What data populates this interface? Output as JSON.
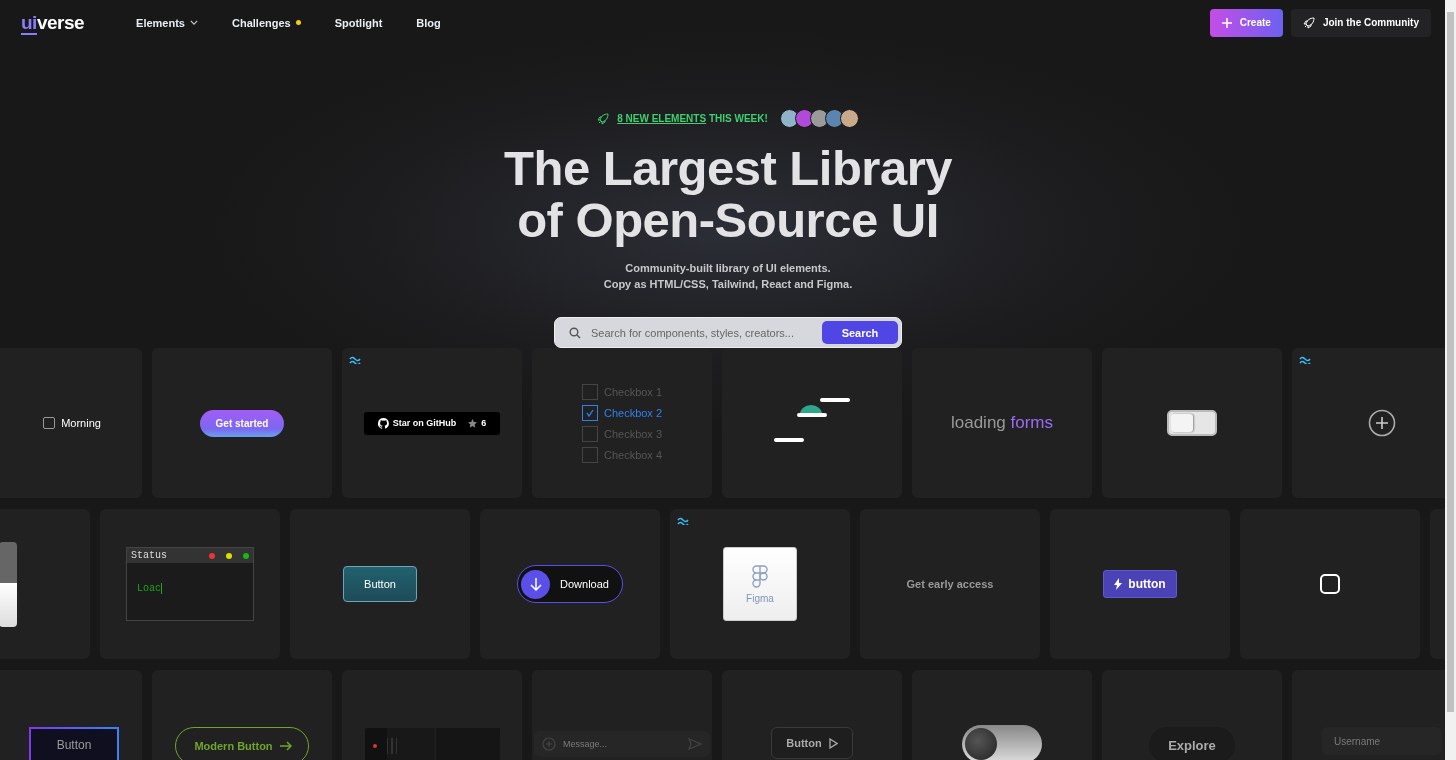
{
  "header": {
    "logo": {
      "accent": "ui",
      "rest": "verse"
    },
    "nav": [
      {
        "label": "Elements",
        "dropdown": true,
        "dot": false
      },
      {
        "label": "Challenges",
        "dropdown": false,
        "dot": true
      },
      {
        "label": "Spotlight",
        "dropdown": false,
        "dot": false
      },
      {
        "label": "Blog",
        "dropdown": false,
        "dot": false
      }
    ],
    "actions": [
      {
        "kind": "primary",
        "label": "Create"
      },
      {
        "kind": "secondary",
        "label": "Join the Community"
      }
    ]
  },
  "hero": {
    "badge": {
      "link": "8 NEW ELEMENTS",
      "rest": "THIS WEEK!"
    },
    "avatars": [
      {
        "color": "#8fb3c9"
      },
      {
        "color": "#b04ad8"
      },
      {
        "color": "#9a9a9a"
      },
      {
        "color": "#5b84b0"
      },
      {
        "color": "#c9a98a"
      }
    ],
    "title": [
      "The Largest Library",
      "of Open-Source UI"
    ],
    "subtitle": [
      "Community-built library of UI elements.",
      "Copy as HTML/CSS, Tailwind, React and Figma."
    ],
    "search": {
      "placeholder": "Search for components, styles, creators...",
      "button": "Search"
    }
  },
  "rows": [
    [
      {
        "kind": "checkbox",
        "label": "Morning",
        "checked": false
      },
      {
        "kind": "gradient-button",
        "label": "Get started"
      },
      {
        "kind": "github-button",
        "label": "Star on GitHub",
        "count": "6",
        "tailwind": true
      },
      {
        "kind": "checkbox-list",
        "items": [
          {
            "label": "Checkbox 1",
            "checked": false
          },
          {
            "label": "Checkbox 2",
            "checked": true
          },
          {
            "label": "Checkbox 3",
            "checked": false
          },
          {
            "label": "Checkbox 4",
            "checked": false
          }
        ]
      },
      {
        "kind": "loader"
      },
      {
        "kind": "loading-text",
        "text": "loading",
        "accent": "forms"
      },
      {
        "kind": "switch",
        "on": false
      },
      {
        "kind": "plus-button",
        "tailwind": true
      }
    ],
    [
      {
        "kind": "panel"
      },
      {
        "kind": "terminal",
        "title": "Status",
        "text": "Loac"
      },
      {
        "kind": "glass-button",
        "label": "Button"
      },
      {
        "kind": "download-button",
        "label": "Download"
      },
      {
        "kind": "figma-card",
        "label": "Figma",
        "tailwind": true
      },
      {
        "kind": "shimmer-text",
        "label": "Get early access"
      },
      {
        "kind": "icon-button",
        "label": "button"
      },
      {
        "kind": "square-checkbox",
        "checked": false
      },
      {
        "kind": "empty"
      }
    ],
    [
      {
        "kind": "outline-button",
        "label": "Button"
      },
      {
        "kind": "pill-button",
        "label": "Modern Button"
      },
      {
        "kind": "player"
      },
      {
        "kind": "message-field",
        "placeholder": "Message..."
      },
      {
        "kind": "play-button",
        "label": "Button"
      },
      {
        "kind": "switch-3d",
        "on": false
      },
      {
        "kind": "dark-button",
        "label": "Explore"
      },
      {
        "kind": "text-field",
        "placeholder": "Username"
      }
    ]
  ]
}
